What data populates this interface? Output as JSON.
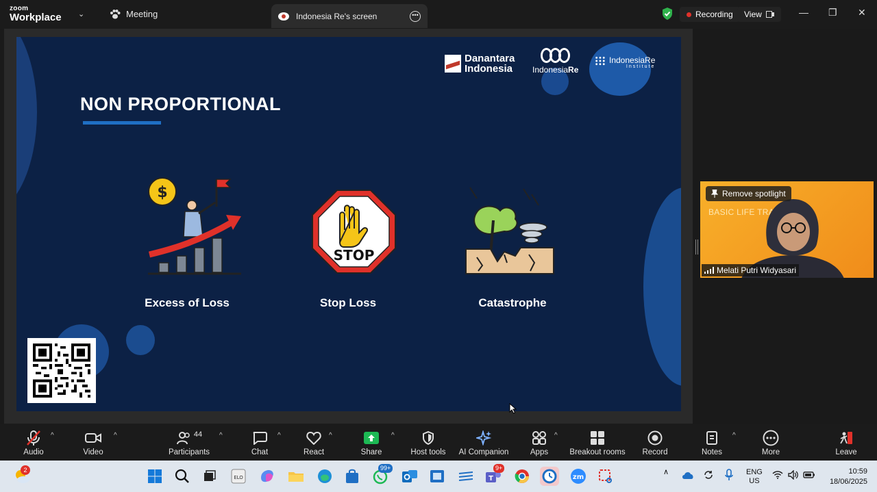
{
  "topbar": {
    "brand_small": "zoom",
    "brand_big": "Workplace",
    "meeting_label": "Meeting",
    "screen_tab_label": "Indonesia Re's screen",
    "recording_label": "Recording",
    "view_label": "View"
  },
  "slide": {
    "title": "NON PROPORTIONAL",
    "logos": {
      "danantara": [
        "Danantara",
        "Indonesia"
      ],
      "indonesia_re": [
        "Indonesia",
        "Re"
      ],
      "institute": [
        "IndonesiaRe",
        "Institute"
      ]
    },
    "items": [
      {
        "label": "Excess of Loss",
        "icon": "growth-chart-icon"
      },
      {
        "label": "Stop Loss",
        "icon": "stop-sign-icon"
      },
      {
        "label": "Catastrophe",
        "icon": "disaster-icon"
      }
    ],
    "stop_text": "STOP",
    "dollar": "$"
  },
  "spotlight": {
    "button_label": "Remove spotlight",
    "participant_name": "Melati Putri Widyasari",
    "video_text": "BASIC LIFE TRAINING"
  },
  "toolbar": {
    "audio": "Audio",
    "video": "Video",
    "participants": "Participants",
    "participants_count": "44",
    "chat": "Chat",
    "react": "React",
    "share": "Share",
    "host_tools": "Host tools",
    "ai_companion": "AI Companion",
    "apps": "Apps",
    "breakout_rooms": "Breakout rooms",
    "record": "Record",
    "notes": "Notes",
    "more": "More",
    "leave": "Leave"
  },
  "taskbar": {
    "weather_badge": "2",
    "whatsapp_badge": "99+",
    "teams_badge": "9+",
    "lang_line1": "ENG",
    "lang_line2": "US",
    "time": "10:59",
    "date": "18/06/2025"
  },
  "colors": {
    "slide_bg": "#0c2145",
    "accent_blue": "#1f6fc4",
    "share_green": "#1db954",
    "spotlight_bg": "#f6a623",
    "leave_red": "#e0312a"
  }
}
